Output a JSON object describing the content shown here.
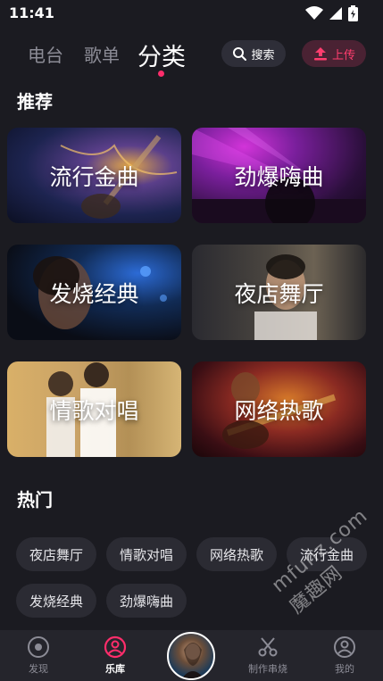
{
  "status_bar": {
    "time": "11:41"
  },
  "top_nav": {
    "tabs": [
      {
        "label": "电台"
      },
      {
        "label": "歌单"
      },
      {
        "label": "分类"
      }
    ],
    "search_label": "搜索",
    "upload_label": "上传",
    "accent_color": "#ff2d6b"
  },
  "recommend": {
    "title": "推荐",
    "cards": [
      {
        "label": "流行金曲"
      },
      {
        "label": "劲爆嗨曲"
      },
      {
        "label": "发烧经典"
      },
      {
        "label": "夜店舞厅"
      },
      {
        "label": "情歌对唱"
      },
      {
        "label": "网络热歌"
      }
    ]
  },
  "hot": {
    "title": "热门",
    "chips": [
      "夜店舞厅",
      "情歌对唱",
      "网络热歌",
      "流行金曲",
      "发烧经典",
      "劲爆嗨曲"
    ]
  },
  "watermark": "mfunz.com 魔趣网",
  "bottom_nav": {
    "items": [
      {
        "label": "发现",
        "icon": "discover-icon"
      },
      {
        "label": "乐库",
        "icon": "library-icon"
      },
      {
        "label": "制作串烧",
        "icon": "scissors-icon"
      },
      {
        "label": "我的",
        "icon": "profile-icon"
      }
    ]
  }
}
